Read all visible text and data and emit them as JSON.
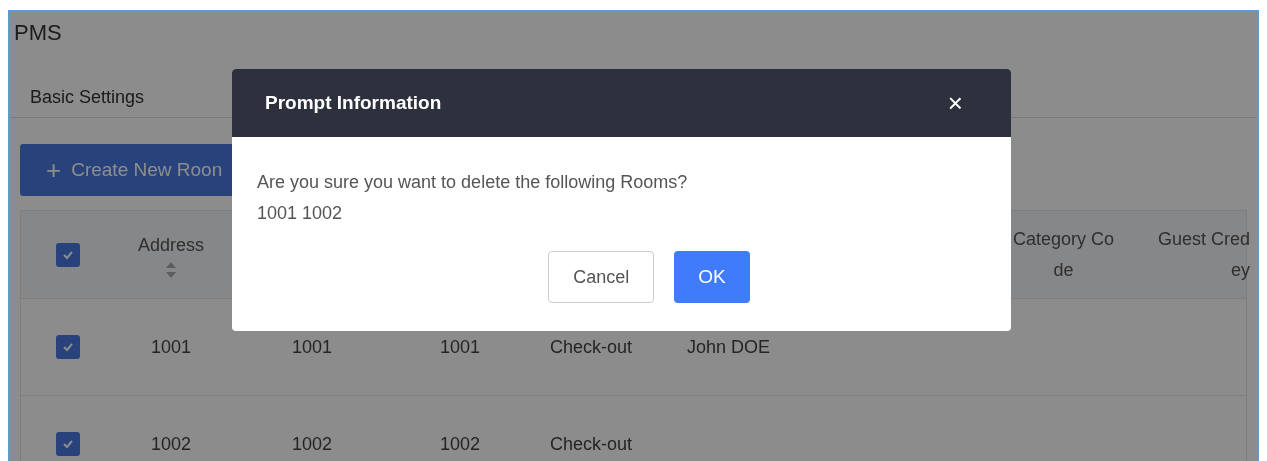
{
  "page": {
    "title": "PMS",
    "tabs": [
      {
        "label": "Basic Settings",
        "selected": true
      }
    ],
    "create_button": {
      "icon": "+",
      "label": "Create New Roon"
    }
  },
  "table": {
    "header_checked": true,
    "columns": [
      {
        "kind": "sort",
        "lines": [
          "Address"
        ]
      },
      {
        "kind": "blank"
      },
      {
        "kind": "blank"
      },
      {
        "kind": "blank"
      },
      {
        "kind": "blank"
      },
      {
        "kind": "plain",
        "lines": [
          "Category Co",
          "de"
        ]
      },
      {
        "kind": "plain",
        "lines": [
          "Guest Cred",
          "ey"
        ]
      }
    ],
    "rows": [
      {
        "checked": true,
        "cells": [
          "1001",
          "1001",
          "1001",
          "Check-out",
          "John DOE"
        ]
      },
      {
        "checked": true,
        "cells": [
          "1002",
          "1002",
          "1002",
          "Check-out"
        ]
      }
    ]
  },
  "dialog": {
    "title": "Prompt Information",
    "close": "×",
    "message": "Are you sure you want to delete the following Rooms?",
    "items": "1001 1002",
    "buttons": [
      {
        "label": "Cancel",
        "kind": "secondary"
      },
      {
        "label": "OK",
        "kind": "primary"
      }
    ]
  }
}
